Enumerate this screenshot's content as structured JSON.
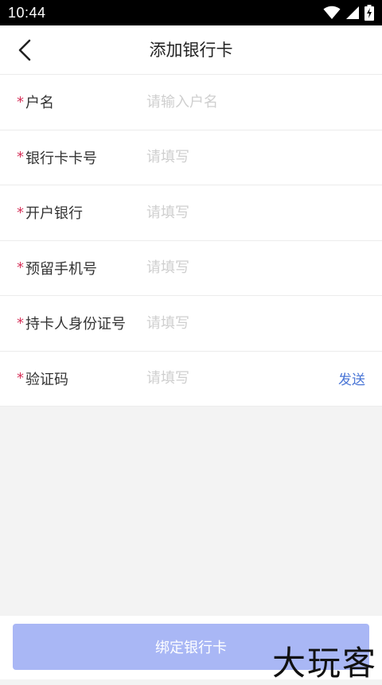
{
  "status_bar": {
    "time": "10:44"
  },
  "header": {
    "title": "添加银行卡"
  },
  "form": {
    "required_mark": "*",
    "rows": [
      {
        "label": "户名",
        "placeholder": "请输入户名"
      },
      {
        "label": "银行卡卡号",
        "placeholder": "请填写"
      },
      {
        "label": "开户银行",
        "placeholder": "请填写"
      },
      {
        "label": "预留手机号",
        "placeholder": "请填写"
      },
      {
        "label": "持卡人身份证号",
        "placeholder": "请填写"
      },
      {
        "label": "验证码",
        "placeholder": "请填写",
        "action": "发送"
      }
    ]
  },
  "footer": {
    "bind_button": "绑定银行卡"
  },
  "watermark": "大玩客",
  "colors": {
    "required": "#d6335b",
    "send_link": "#4a76d6",
    "button_bg": "#a9b7f5"
  }
}
